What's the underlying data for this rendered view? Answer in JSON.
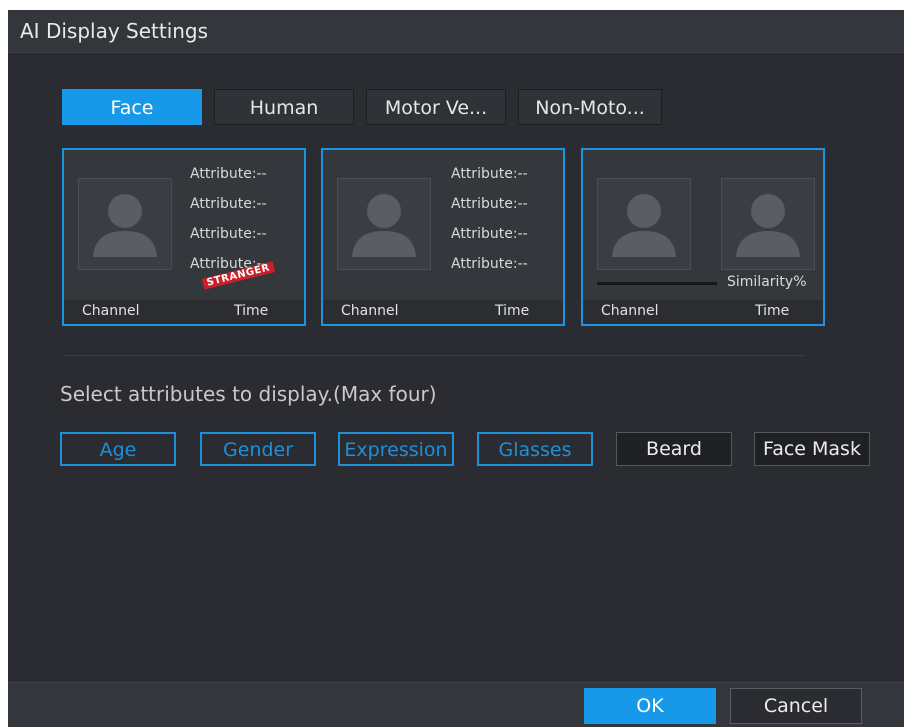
{
  "dialog": {
    "title": "AI Display Settings"
  },
  "tabs": [
    {
      "label": "Face",
      "active": true
    },
    {
      "label": "Human",
      "active": false
    },
    {
      "label": "Motor Ve...",
      "active": false
    },
    {
      "label": "Non-Moto...",
      "active": false
    }
  ],
  "preview_cards": [
    {
      "attributes": [
        "Attribute:--",
        "Attribute:--",
        "Attribute:--",
        "Attribute:--"
      ],
      "stamp": "STRANGER",
      "channel": "Channel",
      "time": "Time"
    },
    {
      "attributes": [
        "Attribute:--",
        "Attribute:--",
        "Attribute:--",
        "Attribute:--"
      ],
      "channel": "Channel",
      "time": "Time"
    },
    {
      "similarity": "Similarity%",
      "channel": "Channel",
      "time": "Time"
    }
  ],
  "attributes_section": {
    "hint": "Select attributes to display.(Max four)",
    "options": [
      {
        "label": "Age",
        "selected": true
      },
      {
        "label": "Gender",
        "selected": true
      },
      {
        "label": "Expression",
        "selected": true
      },
      {
        "label": "Glasses",
        "selected": true
      },
      {
        "label": "Beard",
        "selected": false
      },
      {
        "label": "Face Mask",
        "selected": false
      }
    ]
  },
  "footer": {
    "ok_label": "OK",
    "cancel_label": "Cancel"
  },
  "colors": {
    "accent": "#1798e8",
    "background": "#2a2c31",
    "card_border": "#1d93e1"
  }
}
